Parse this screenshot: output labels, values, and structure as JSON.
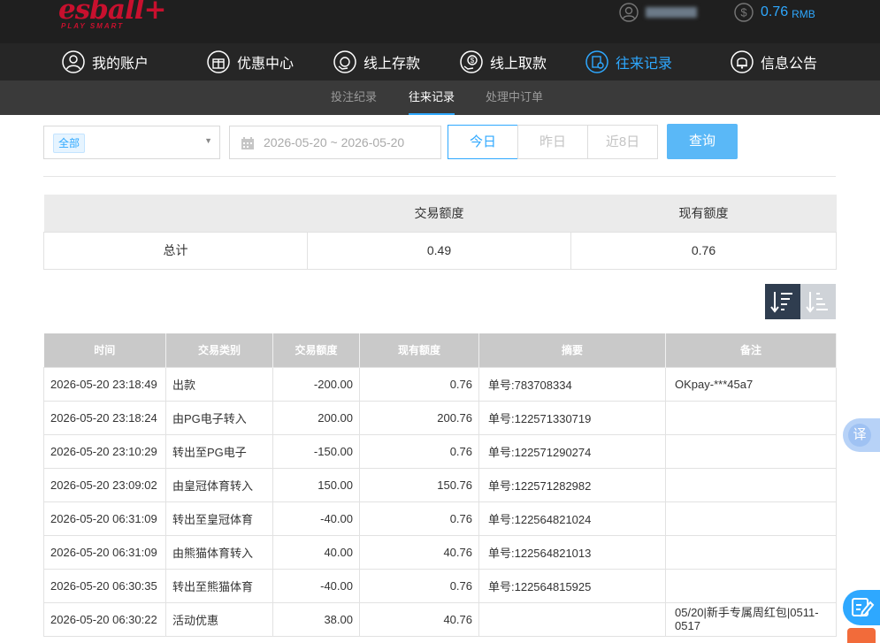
{
  "header": {
    "logo_text": "esball+",
    "logo_tagline": "PLAY SMART",
    "username": "",
    "balance": "0.76",
    "currency": "RMB"
  },
  "nav": {
    "items": [
      {
        "label": "我的账户",
        "icon": "user-icon"
      },
      {
        "label": "优惠中心",
        "icon": "gift-icon"
      },
      {
        "label": "线上存款",
        "icon": "deposit-icon"
      },
      {
        "label": "线上取款",
        "icon": "withdraw-icon"
      },
      {
        "label": "往来记录",
        "icon": "records-icon"
      },
      {
        "label": "信息公告",
        "icon": "bell-icon"
      }
    ],
    "active_index": 4
  },
  "subnav": {
    "items": [
      "投注纪录",
      "往来记录",
      "处理中订单"
    ],
    "active_index": 1
  },
  "filters": {
    "type_value": "全部",
    "date_range": "2026-05-20 ~ 2026-05-20",
    "range_buttons": [
      "今日",
      "昨日",
      "近8日"
    ],
    "range_active_index": 0,
    "query_label": "查询"
  },
  "summary": {
    "col_transaction": "交易额度",
    "col_balance": "现有额度",
    "row_label": "总计",
    "transaction_total": "0.49",
    "balance_total": "0.76"
  },
  "records": {
    "headers": [
      "时间",
      "交易类别",
      "交易额度",
      "现有额度",
      "摘要",
      "备注"
    ],
    "rows": [
      [
        "2026-05-20 23:18:49",
        "出款",
        "-200.00",
        "0.76",
        "单号:783708334",
        "OKpay-***45a7"
      ],
      [
        "2026-05-20 23:18:24",
        "由PG电子转入",
        "200.00",
        "200.76",
        "单号:122571330719",
        ""
      ],
      [
        "2026-05-20 23:10:29",
        "转出至PG电子",
        "-150.00",
        "0.76",
        "单号:122571290274",
        ""
      ],
      [
        "2026-05-20 23:09:02",
        "由皇冠体育转入",
        "150.00",
        "150.76",
        "单号:122571282982",
        ""
      ],
      [
        "2026-05-20 06:31:09",
        "转出至皇冠体育",
        "-40.00",
        "0.76",
        "单号:122564821024",
        ""
      ],
      [
        "2026-05-20 06:31:09",
        "由熊猫体育转入",
        "40.00",
        "40.76",
        "单号:122564821013",
        ""
      ],
      [
        "2026-05-20 06:30:35",
        "转出至熊猫体育",
        "-40.00",
        "0.76",
        "单号:122564815925",
        ""
      ],
      [
        "2026-05-20 06:30:22",
        "活动优惠",
        "38.00",
        "40.76",
        "",
        "05/20|新手专属周红包|0511-0517"
      ]
    ]
  },
  "floating": {
    "translate_label": "译"
  },
  "colors": {
    "accent": "#2ea8ff",
    "brand_red": "#c8102e",
    "header_bg": "#1f1f1f"
  }
}
